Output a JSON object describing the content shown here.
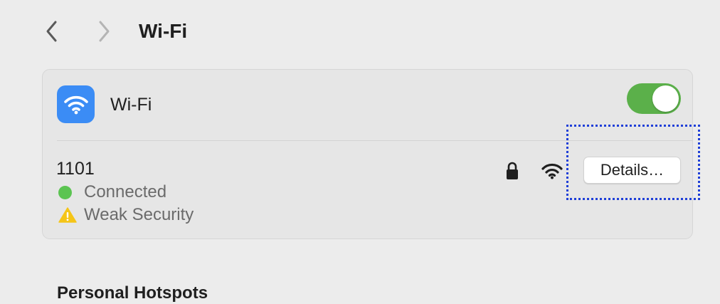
{
  "nav": {
    "back_icon": "chevron-left-icon",
    "forward_icon": "chevron-right-icon"
  },
  "page": {
    "title": "Wi-Fi"
  },
  "wifi_card": {
    "icon": "wifi-icon",
    "label": "Wi-Fi",
    "toggle_on": true,
    "toggle_color": "#5bb04a"
  },
  "network": {
    "name": "1101",
    "status": "Connected",
    "status_color": "#5bc451",
    "security_warning": "Weak Security",
    "lock_icon": "lock-icon",
    "signal_icon": "wifi-signal-icon",
    "details_label": "Details…"
  },
  "annotation": {
    "color": "#1f3fd8"
  },
  "next_section": {
    "heading": "Personal Hotspots"
  }
}
